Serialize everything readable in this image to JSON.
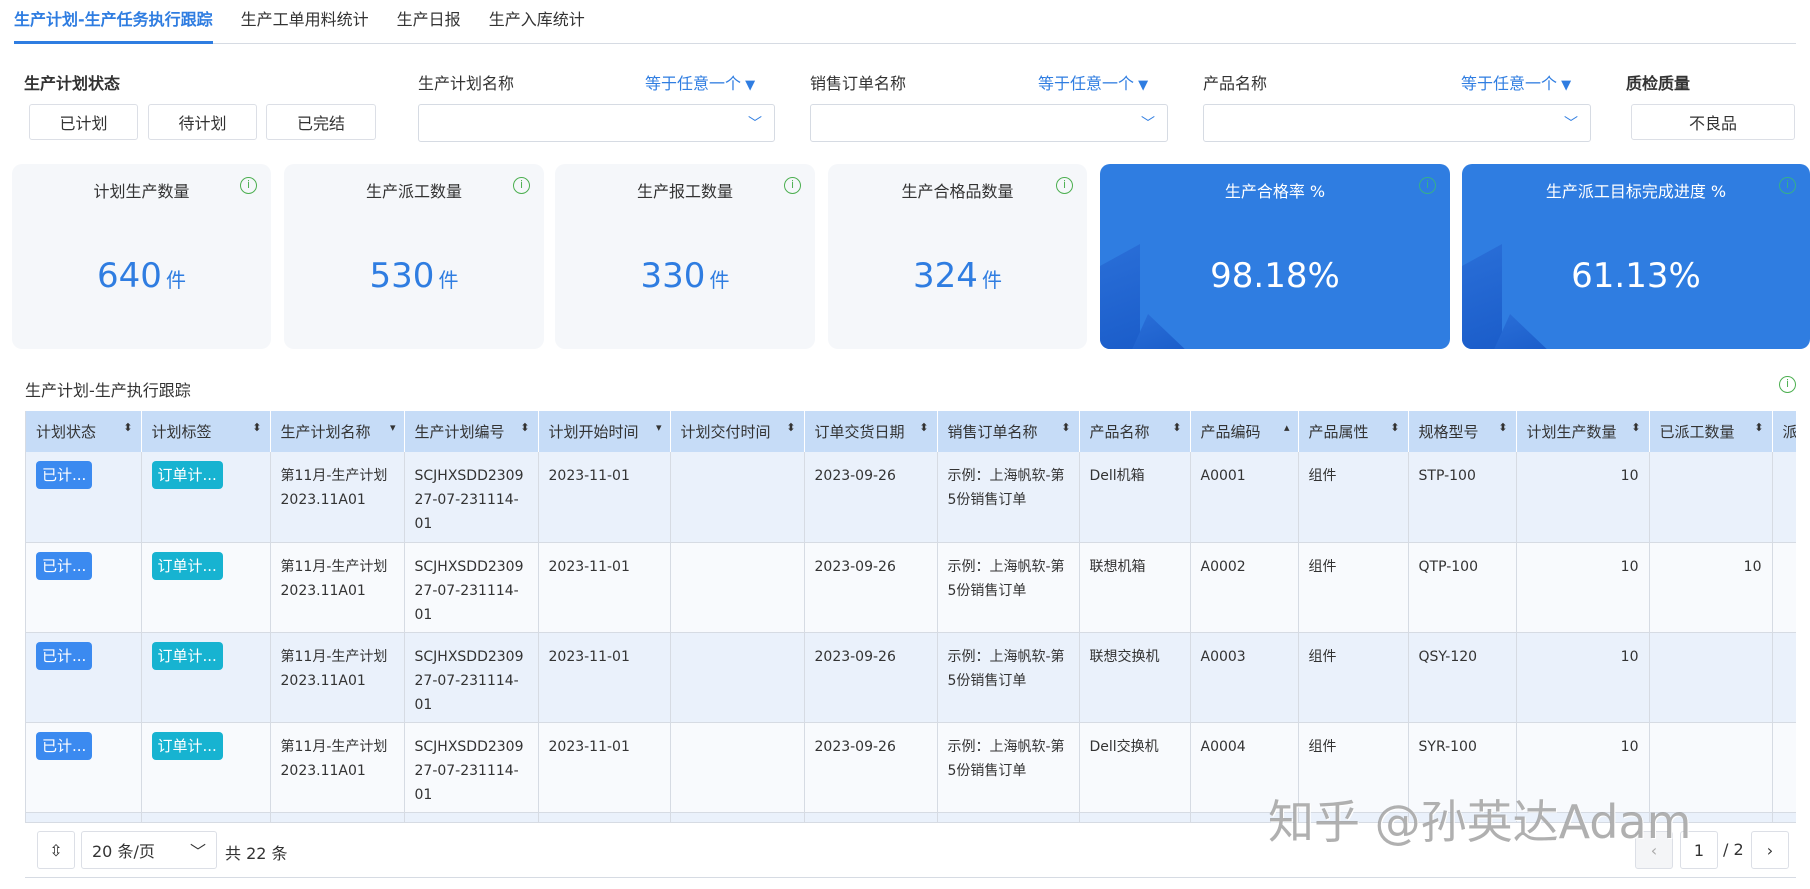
{
  "tabs": [
    "生产计划-生产任务执行跟踪",
    "生产工单用料统计",
    "生产日报",
    "生产入库统计"
  ],
  "filters": {
    "status_label": "生产计划状态",
    "status_options": [
      "已计划",
      "待计划",
      "已完结"
    ],
    "plan_name_label": "生产计划名称",
    "plan_name_op": "等于任意一个",
    "order_name_label": "销售订单名称",
    "order_name_op": "等于任意一个",
    "product_name_label": "产品名称",
    "product_name_op": "等于任意一个",
    "quality_label": "质检质量",
    "quality_option": "不良品"
  },
  "cards": [
    {
      "title": "计划生产数量",
      "value": "640",
      "unit": "件"
    },
    {
      "title": "生产派工数量",
      "value": "530",
      "unit": "件"
    },
    {
      "title": "生产报工数量",
      "value": "330",
      "unit": "件"
    },
    {
      "title": "生产合格品数量",
      "value": "324",
      "unit": "件"
    },
    {
      "title": "生产合格率 %",
      "value": "98.18%"
    },
    {
      "title": "生产派工目标完成进度 %",
      "value": "61.13%"
    }
  ],
  "table": {
    "title": "生产计划-生产执行跟踪",
    "columns": [
      "计划状态",
      "计划标签",
      "生产计划名称",
      "生产计划编号",
      "计划开始时间",
      "计划交付时间",
      "订单交货日期",
      "销售订单名称",
      "产品名称",
      "产品编码",
      "产品属性",
      "规格型号",
      "计划生产数量",
      "已派工数量",
      "派"
    ],
    "sort_icons": [
      "⬍",
      "⬍",
      "▾",
      "⬍",
      "▾",
      "⬍",
      "⬍",
      "⬍",
      "⬍",
      "▴",
      "⬍",
      "⬍",
      "⬍",
      "⬍",
      ""
    ],
    "rows": [
      [
        "已计...",
        "订单计...",
        "第11月-生产计划2023.11A01",
        "SCJHXSDD230927-07-231114-01",
        "2023-11-01",
        "",
        "2023-09-26",
        "示例：上海帆软-第5份销售订单",
        "Dell机箱",
        "A0001",
        "组件",
        "STP-100",
        "10",
        "",
        ""
      ],
      [
        "已计...",
        "订单计...",
        "第11月-生产计划2023.11A01",
        "SCJHXSDD230927-07-231114-01",
        "2023-11-01",
        "",
        "2023-09-26",
        "示例：上海帆软-第5份销售订单",
        "联想机箱",
        "A0002",
        "组件",
        "QTP-100",
        "10",
        "10",
        ""
      ],
      [
        "已计...",
        "订单计...",
        "第11月-生产计划2023.11A01",
        "SCJHXSDD230927-07-231114-01",
        "2023-11-01",
        "",
        "2023-09-26",
        "示例：上海帆软-第5份销售订单",
        "联想交换机",
        "A0003",
        "组件",
        "QSY-120",
        "10",
        "",
        ""
      ],
      [
        "已计...",
        "订单计...",
        "第11月-生产计划2023.11A01",
        "SCJHXSDD230927-07-231114-01",
        "2023-11-01",
        "",
        "2023-09-26",
        "示例：上海帆软-第5份销售订单",
        "Dell交换机",
        "A0004",
        "组件",
        "SYR-100",
        "10",
        "",
        ""
      ]
    ]
  },
  "pagination": {
    "page_size": "20 条/页",
    "total": "共 22 条",
    "current_page": "1",
    "total_pages": "/ 2"
  },
  "watermark": "知乎 @孙英达Adam",
  "colors": {
    "accent": "#2f7de1",
    "header": "#c6dcf7",
    "badge_status": "#3b8af0",
    "badge_tag": "#17b3d1"
  }
}
